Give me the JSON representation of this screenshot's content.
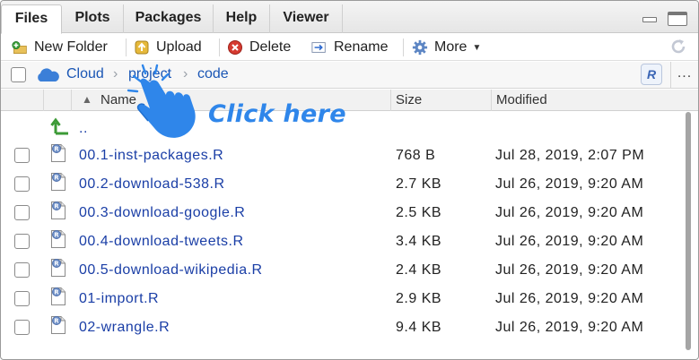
{
  "tabs": [
    {
      "label": "Files",
      "active": true
    },
    {
      "label": "Plots"
    },
    {
      "label": "Packages"
    },
    {
      "label": "Help"
    },
    {
      "label": "Viewer"
    }
  ],
  "toolbar": {
    "new_folder": "New Folder",
    "upload": "Upload",
    "delete": "Delete",
    "rename": "Rename",
    "more": "More"
  },
  "breadcrumb": {
    "items": [
      "Cloud",
      "project",
      "code"
    ]
  },
  "columns": {
    "name": "Name",
    "size": "Size",
    "modified": "Modified"
  },
  "parent_dir": "..",
  "files": [
    {
      "name": "00.1-inst-packages.R",
      "size": "768 B",
      "modified": "Jul 28, 2019, 2:07 PM"
    },
    {
      "name": "00.2-download-538.R",
      "size": "2.7 KB",
      "modified": "Jul 26, 2019, 9:20 AM"
    },
    {
      "name": "00.3-download-google.R",
      "size": "2.5 KB",
      "modified": "Jul 26, 2019, 9:20 AM"
    },
    {
      "name": "00.4-download-tweets.R",
      "size": "3.4 KB",
      "modified": "Jul 26, 2019, 9:20 AM"
    },
    {
      "name": "00.5-download-wikipedia.R",
      "size": "2.4 KB",
      "modified": "Jul 26, 2019, 9:20 AM"
    },
    {
      "name": "01-import.R",
      "size": "2.9 KB",
      "modified": "Jul 26, 2019, 9:20 AM"
    },
    {
      "name": "02-wrangle.R",
      "size": "9.4 KB",
      "modified": "Jul 26, 2019, 9:20 AM"
    }
  ],
  "annotation": {
    "text": "Click here",
    "color": "#2f86ea"
  },
  "colors": {
    "link": "#1a3ea6",
    "breadcrumb_link": "#1a56b5",
    "cloud": "#3b7fd8"
  },
  "icons": {
    "new_folder": "folder-plus-icon",
    "upload": "upload-icon",
    "delete": "delete-icon",
    "rename": "rename-icon",
    "more": "gear-icon",
    "refresh": "refresh-icon",
    "cloud": "cloud-icon",
    "parent": "up-arrow-icon",
    "file": "r-file-icon",
    "project": "r-project-icon",
    "hand": "pointing-hand-icon"
  }
}
